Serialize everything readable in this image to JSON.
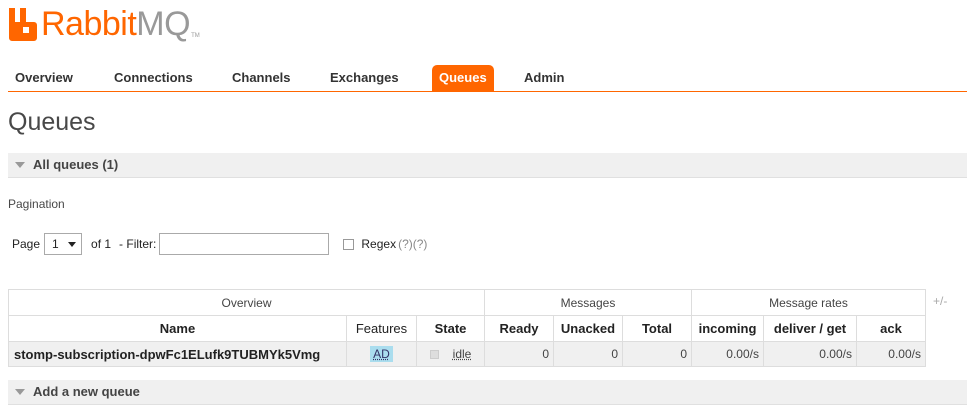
{
  "logo": {
    "brand": "Rabbit",
    "brand_suffix": "MQ",
    "tm": "TM"
  },
  "tabs": [
    {
      "label": "Overview",
      "active": false
    },
    {
      "label": "Connections",
      "active": false
    },
    {
      "label": "Channels",
      "active": false
    },
    {
      "label": "Exchanges",
      "active": false
    },
    {
      "label": "Queues",
      "active": true
    },
    {
      "label": "Admin",
      "active": false
    }
  ],
  "page_title": "Queues",
  "all_queues": {
    "label": "All queues (1)"
  },
  "pagination": {
    "label": "Pagination",
    "page_label": "Page",
    "page_value": "1",
    "of_label": "of 1",
    "filter_label": "- Filter:",
    "filter_value": "",
    "regex_label": "Regex",
    "help1": "(?)",
    "help2": "(?)"
  },
  "table": {
    "groups": [
      "Overview",
      "Messages",
      "Message rates"
    ],
    "plus_minus": "+/-",
    "headers": [
      "Name",
      "Features",
      "State",
      "Ready",
      "Unacked",
      "Total",
      "incoming",
      "deliver / get",
      "ack"
    ],
    "rows": [
      {
        "name": "stomp-subscription-dpwFc1ELufk9TUBMYk5Vmg",
        "features": "AD",
        "state": "idle",
        "ready": "0",
        "unacked": "0",
        "total": "0",
        "incoming": "0.00/s",
        "deliver_get": "0.00/s",
        "ack": "0.00/s"
      }
    ]
  },
  "add_queue": {
    "label": "Add a new queue"
  },
  "colors": {
    "accent": "#ff6600",
    "row_bg": "#f0f0f0",
    "badge_bg": "#aaddee"
  }
}
